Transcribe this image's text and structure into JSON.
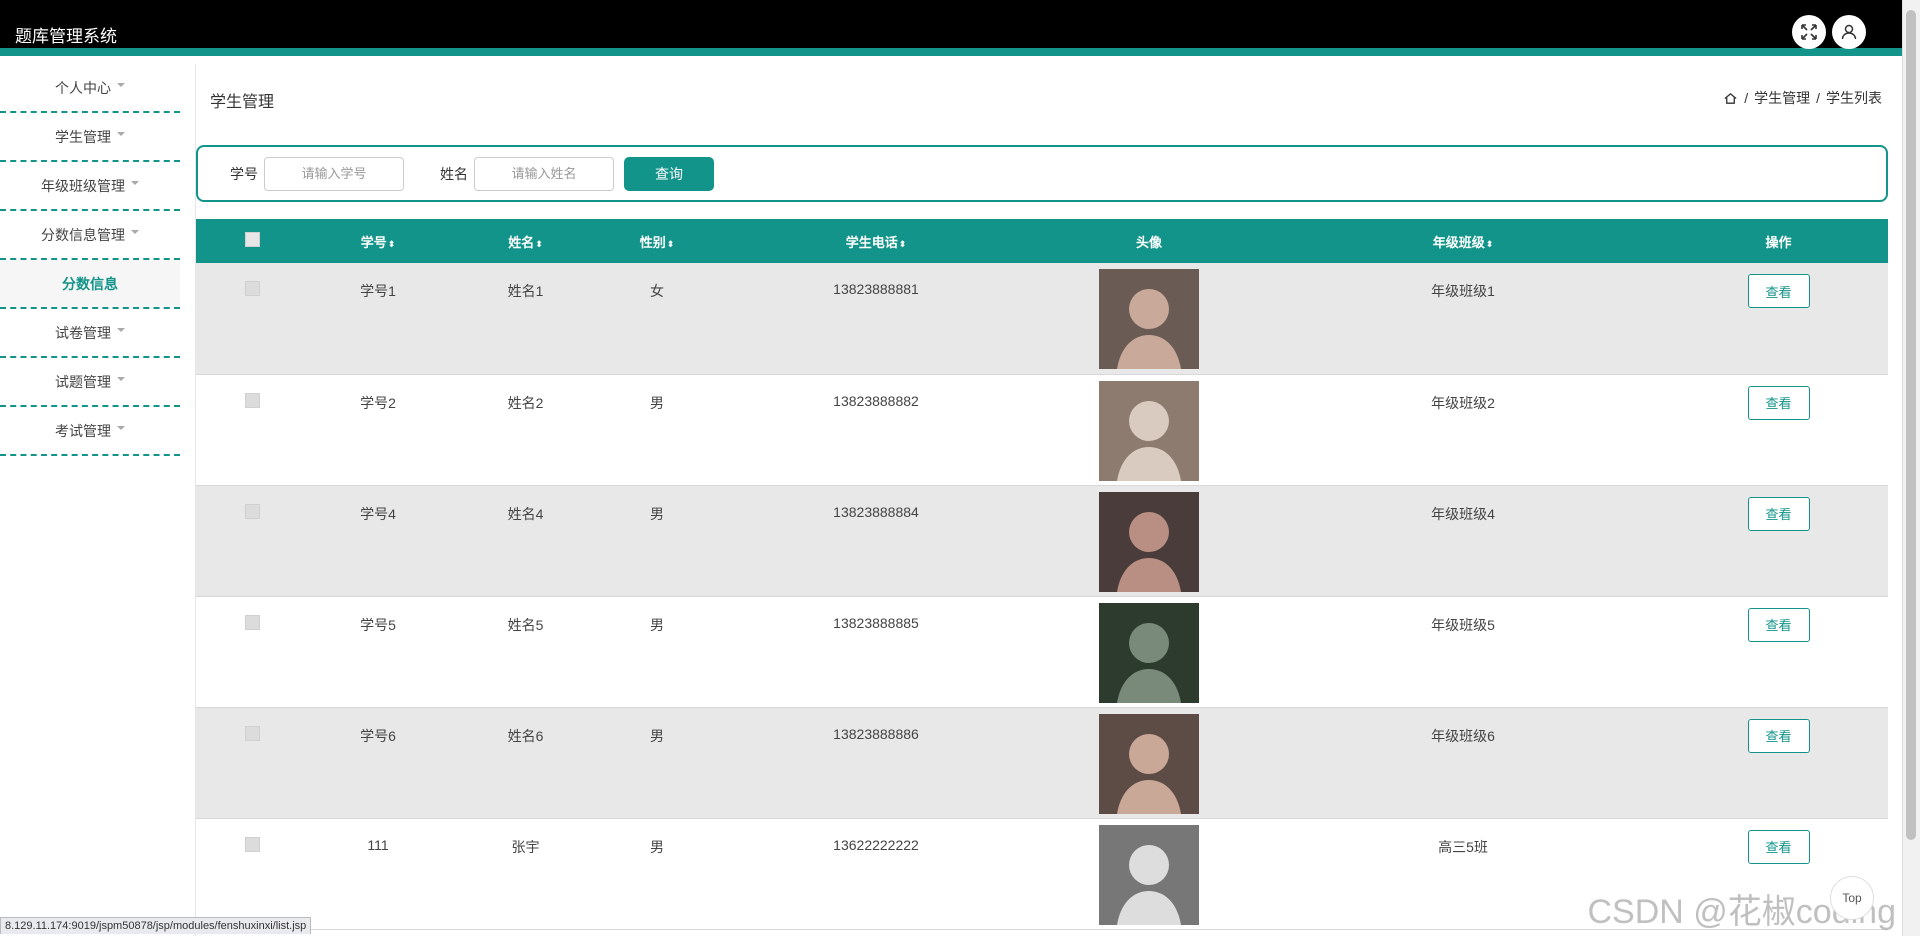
{
  "app": {
    "title": "题库管理系统"
  },
  "sidebar": {
    "items": [
      {
        "label": "个人中心",
        "caret": true
      },
      {
        "label": "学生管理",
        "caret": true
      },
      {
        "label": "年级班级管理",
        "caret": true
      },
      {
        "label": "分数信息管理",
        "caret": true
      },
      {
        "label": "分数信息",
        "caret": false,
        "active": true
      },
      {
        "label": "试卷管理",
        "caret": true
      },
      {
        "label": "试题管理",
        "caret": true
      },
      {
        "label": "考试管理",
        "caret": true
      }
    ]
  },
  "header": {
    "page_title": "学生管理",
    "breadcrumb": [
      "学生管理",
      "学生列表"
    ],
    "separator": "/"
  },
  "search": {
    "student_no_label": "学号",
    "student_no_placeholder": "请输入学号",
    "name_label": "姓名",
    "name_placeholder": "请输入姓名",
    "query_label": "查询"
  },
  "table": {
    "columns": [
      "学号",
      "姓名",
      "性别",
      "学生电话",
      "头像",
      "年级班级",
      "操作"
    ],
    "sort_glyph": "⬍",
    "rows": [
      {
        "no": "学号1",
        "name": "姓名1",
        "gender": "女",
        "phone": "13823888881",
        "class": "年级班级1",
        "action": "查看"
      },
      {
        "no": "学号2",
        "name": "姓名2",
        "gender": "男",
        "phone": "13823888882",
        "class": "年级班级2",
        "action": "查看"
      },
      {
        "no": "学号4",
        "name": "姓名4",
        "gender": "男",
        "phone": "13823888884",
        "class": "年级班级4",
        "action": "查看"
      },
      {
        "no": "学号5",
        "name": "姓名5",
        "gender": "男",
        "phone": "13823888885",
        "class": "年级班级5",
        "action": "查看"
      },
      {
        "no": "学号6",
        "name": "姓名6",
        "gender": "男",
        "phone": "13823888886",
        "class": "年级班级6",
        "action": "查看"
      },
      {
        "no": "111",
        "name": "张宇",
        "gender": "男",
        "phone": "13622222222",
        "class": "高三5班",
        "action": "查看"
      }
    ]
  },
  "status": {
    "url": "8.129.11.174:9019/jspm50878/jsp/modules/fenshuxinxi/list.jsp"
  },
  "float": {
    "top_label": "Top"
  },
  "watermark": "CSDN @花椒coding",
  "colors": {
    "accent": "#13948a",
    "topbar": "#000000"
  }
}
